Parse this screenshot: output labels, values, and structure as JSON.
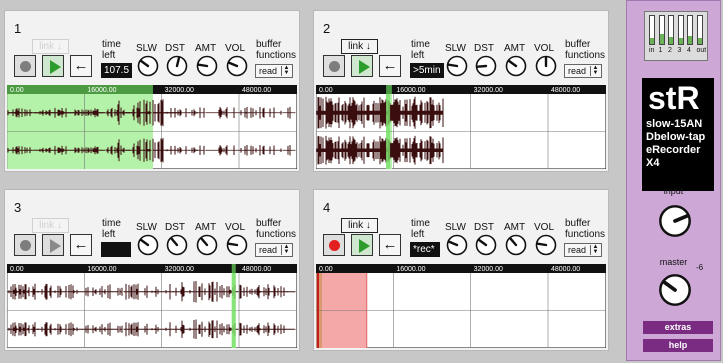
{
  "panels": [
    {
      "number": "1",
      "link_label": "link",
      "link_active": false,
      "rec_active": false,
      "play_active": true,
      "back_label": "←",
      "time_label": "time left",
      "time_value": "107.5",
      "knobs": [
        {
          "label": "SLW",
          "level": 0.3
        },
        {
          "label": "DST",
          "level": 0.55
        },
        {
          "label": "AMT",
          "level": 0.2
        },
        {
          "label": "VOL",
          "level": 0.25
        }
      ],
      "buffer_label": "buffer functions",
      "buffer_value": "read",
      "waveform": {
        "ticks": [
          "0.00",
          "16000.00",
          "32000.00",
          "48000.00"
        ],
        "x_max": 60000,
        "highlight": {
          "from": 0,
          "to": 30200,
          "color": "green"
        },
        "playhead": null,
        "density": "dense-left-sparse-right"
      }
    },
    {
      "number": "2",
      "link_label": "link",
      "link_active": true,
      "rec_active": false,
      "play_active": true,
      "back_label": "←",
      "time_label": "time left",
      "time_value": ">5min",
      "knobs": [
        {
          "label": "SLW",
          "level": 0.2
        },
        {
          "label": "DST",
          "level": 0.15
        },
        {
          "label": "AMT",
          "level": 0.3
        },
        {
          "label": "VOL",
          "level": 0.5
        }
      ],
      "buffer_label": "buffer functions",
      "buffer_value": "read",
      "waveform": {
        "ticks": [
          "0.00",
          "16000.00",
          "32000.00",
          "48000.00"
        ],
        "x_max": 60000,
        "highlight": {
          "from": 14500,
          "to": 15700,
          "color": "green"
        },
        "playhead": null,
        "density": "heavy-left"
      }
    },
    {
      "number": "3",
      "link_label": "link",
      "link_active": false,
      "rec_active": false,
      "play_active": false,
      "back_label": "←",
      "time_label": "time left",
      "time_value": "",
      "knobs": [
        {
          "label": "SLW",
          "level": 0.3
        },
        {
          "label": "DST",
          "level": 0.35
        },
        {
          "label": "AMT",
          "level": 0.35
        },
        {
          "label": "VOL",
          "level": 0.2
        }
      ],
      "buffer_label": "buffer functions",
      "buffer_value": "read",
      "waveform": {
        "ticks": [
          "0.00",
          "16000.00",
          "32000.00",
          "48000.00"
        ],
        "x_max": 60000,
        "highlight": {
          "from": 46500,
          "to": 47300,
          "color": "green"
        },
        "playhead": null,
        "density": "moderate"
      }
    },
    {
      "number": "4",
      "link_label": "link",
      "link_active": true,
      "rec_active": true,
      "play_active": true,
      "back_label": "←",
      "time_label": "time left",
      "time_value": "*rec*",
      "knobs": [
        {
          "label": "SLW",
          "level": 0.25
        },
        {
          "label": "DST",
          "level": 0.3
        },
        {
          "label": "AMT",
          "level": 0.35
        },
        {
          "label": "VOL",
          "level": 0.2
        }
      ],
      "buffer_label": "buffer functions",
      "buffer_value": "read",
      "waveform": {
        "ticks": [
          "0.00",
          "16000.00",
          "32000.00",
          "48000.00"
        ],
        "x_max": 60000,
        "highlight": {
          "from": 0,
          "to": 10500,
          "color": "red"
        },
        "playhead": 500,
        "density": "none"
      }
    }
  ],
  "right": {
    "vu": [
      {
        "label": "in",
        "level": 0.2
      },
      {
        "label": "1",
        "level": 0.35
      },
      {
        "label": "2",
        "level": 0.25
      },
      {
        "label": "3",
        "level": 0.2
      },
      {
        "label": "4",
        "level": 0.3
      },
      {
        "label": "out",
        "level": 0.2
      }
    ],
    "logo": "stR",
    "title_lines": [
      "slow-15AN",
      "Dbelow-tap",
      "eRecorder",
      "X4"
    ],
    "input_label": "input",
    "input_level": 0.75,
    "master_label": "master",
    "master_db": "-6",
    "master_level": 0.3,
    "extras_label": "extras",
    "help_label": "help"
  },
  "colors": {
    "green_region": "#b5f2a9",
    "green_mark": "#7be06b",
    "red_region": "#f5a8a8",
    "red_mark": "#e26767",
    "waveform": "#3a0e0e",
    "panel_bg": "#f2f2f2",
    "right_bg": "#cda7d6",
    "purple_button": "#7a2c82",
    "vu_fill": "#69b257"
  },
  "icons": {
    "record": "record-circle-icon",
    "play": "play-triangle-icon",
    "back": "back-arrow-icon",
    "link": "link-down-arrow-icon"
  }
}
